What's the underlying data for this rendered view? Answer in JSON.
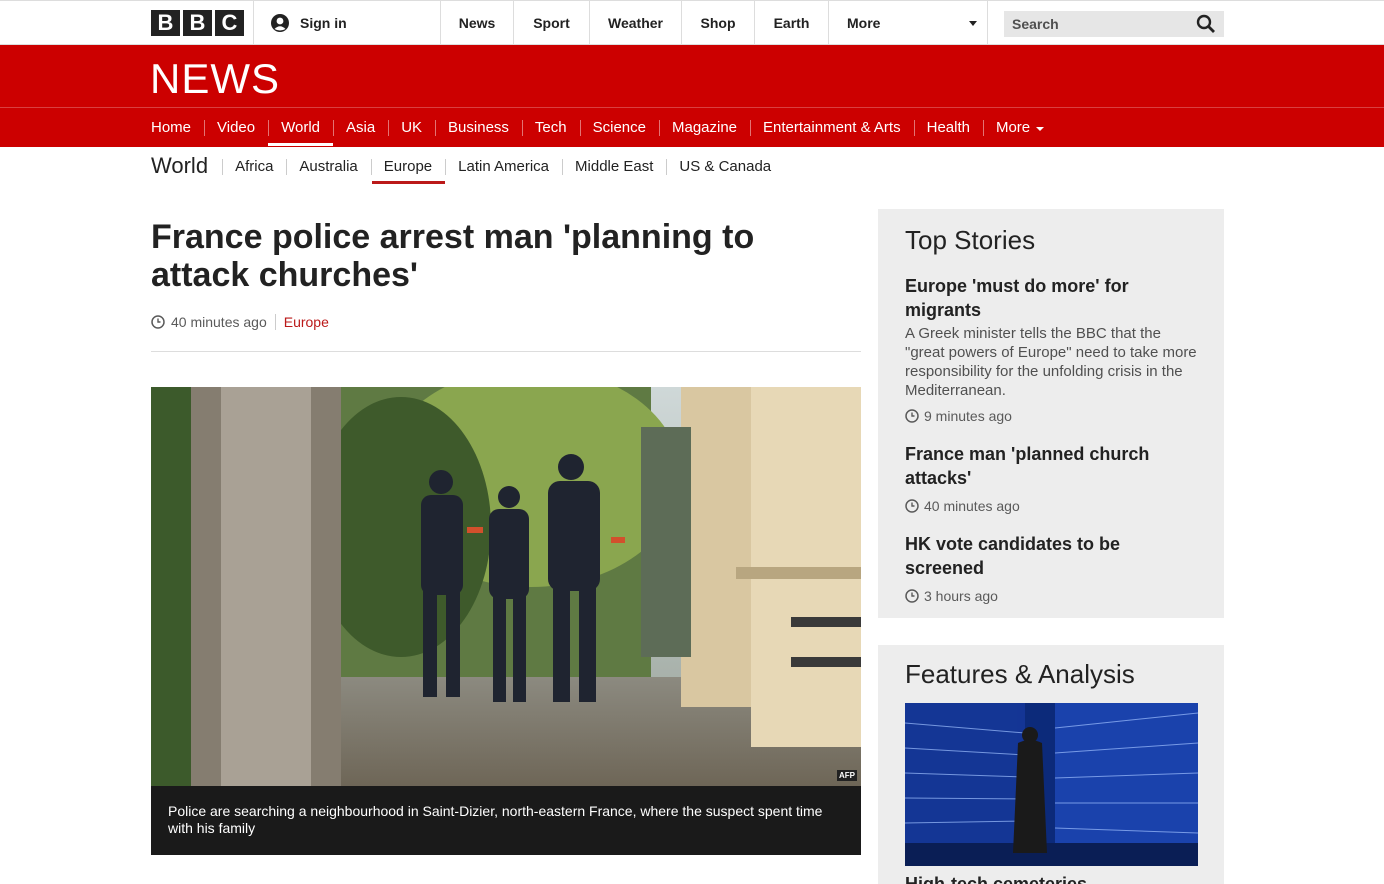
{
  "masthead": {
    "logo_letters": [
      "B",
      "B",
      "C"
    ],
    "signin_label": "Sign in",
    "nav": [
      {
        "label": "News"
      },
      {
        "label": "Sport"
      },
      {
        "label": "Weather"
      },
      {
        "label": "Shop"
      },
      {
        "label": "Earth"
      },
      {
        "label": "More"
      }
    ],
    "search_placeholder": "Search"
  },
  "news": {
    "logo_text": "NEWS",
    "nav": [
      {
        "label": "Home"
      },
      {
        "label": "Video"
      },
      {
        "label": "World"
      },
      {
        "label": "Asia"
      },
      {
        "label": "UK"
      },
      {
        "label": "Business"
      },
      {
        "label": "Tech"
      },
      {
        "label": "Science"
      },
      {
        "label": "Magazine"
      },
      {
        "label": "Entertainment & Arts"
      },
      {
        "label": "Health"
      },
      {
        "label": "More"
      }
    ],
    "active_nav": "World"
  },
  "subnav": {
    "title": "World",
    "items": [
      {
        "label": "Africa"
      },
      {
        "label": "Australia"
      },
      {
        "label": "Europe"
      },
      {
        "label": "Latin America"
      },
      {
        "label": "Middle East"
      },
      {
        "label": "US & Canada"
      }
    ],
    "active": "Europe"
  },
  "article": {
    "headline": "France police arrest man 'planning to attack churches'",
    "timestamp": "40 minutes ago",
    "category": "Europe",
    "image_credit": "AFP",
    "caption": "Police are searching a neighbourhood in Saint-Dizier, north-eastern France, where the suspect spent time with his family"
  },
  "sidebar": {
    "top_stories_title": "Top Stories",
    "stories": [
      {
        "title": "Europe 'must do more' for migrants",
        "summary": "A Greek minister tells the BBC that the \"great powers of Europe\" need to take more responsibility for the unfolding crisis in the Mediterranean.",
        "time": "9 minutes ago"
      },
      {
        "title": "France man 'planned church attacks'",
        "time": "40 minutes ago"
      },
      {
        "title": "HK vote candidates to be screened",
        "time": "3 hours ago"
      }
    ],
    "features_title": "Features & Analysis",
    "feature_title": "High-tech cemeteries"
  },
  "colors": {
    "brand_red": "#bb1919",
    "news_bar": "#cc0000"
  }
}
